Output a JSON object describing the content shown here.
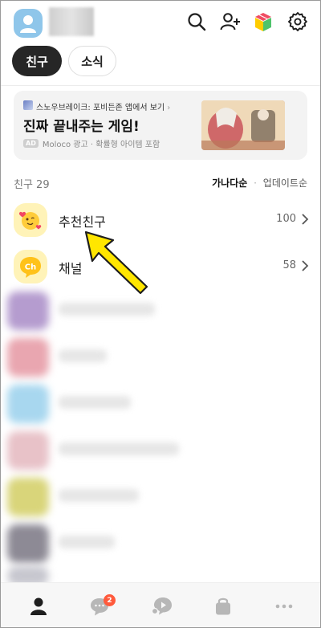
{
  "header": {
    "icons": [
      "search-icon",
      "add-friend-icon",
      "gift-icon",
      "settings-icon"
    ]
  },
  "tabs": [
    {
      "label": "친구",
      "active": true
    },
    {
      "label": "소식",
      "active": false
    }
  ],
  "ad": {
    "source": "스노우브레이크: 포비든존 앱에서 보기",
    "title": "진짜 끝내주는 게임!",
    "badge": "AD",
    "meta": "Moloco 광고 · 확률형 아이템 포함"
  },
  "friends_section": {
    "label": "친구 29",
    "sort_active": "가나다순",
    "sort_separator": "·",
    "sort_inactive": "업데이트순"
  },
  "rows": [
    {
      "label": "추천친구",
      "count": "100",
      "icon": "recommended-friends-icon"
    },
    {
      "label": "채널",
      "count": "58",
      "icon": "channel-icon"
    }
  ],
  "bottom_nav": {
    "items": [
      "friends-icon",
      "chats-icon",
      "openchat-icon",
      "shopping-icon",
      "more-icon"
    ],
    "chat_badge": "2"
  },
  "colors": {
    "accent_yellow": "#fee500",
    "tab_active_bg": "#262626",
    "badge_red": "#ff5a3c"
  }
}
